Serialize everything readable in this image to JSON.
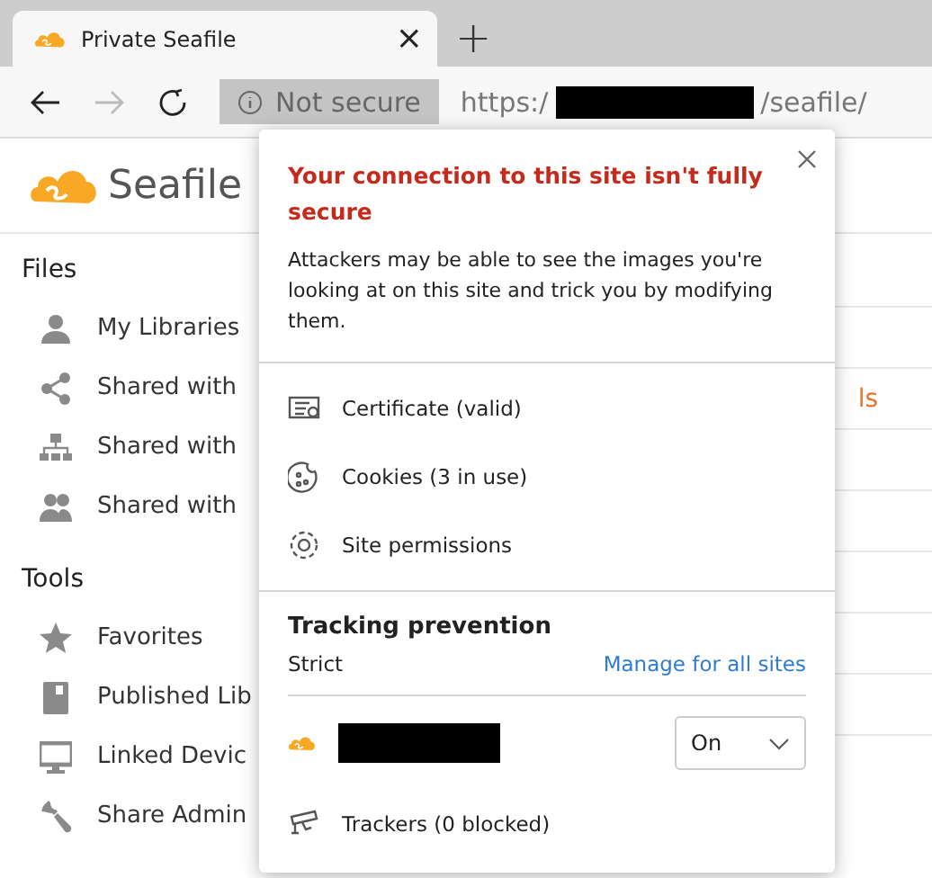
{
  "tabs": [
    {
      "title": "Private Seafile",
      "selected": true,
      "close": "×"
    }
  ],
  "new_tab": "+",
  "address": {
    "security": "Not secure",
    "url_start": "https:/",
    "url_end": "/seafile/"
  },
  "site": {
    "logo_text": "Seafile"
  },
  "sidebar": [
    {
      "heading": "Files",
      "items": [
        {
          "label": "My Libraries"
        },
        {
          "label": "Shared with"
        },
        {
          "label": "Shared with"
        },
        {
          "label": "Shared with"
        }
      ]
    },
    {
      "heading": "Tools",
      "items": [
        {
          "label": "Favorites"
        },
        {
          "label": "Published Lib"
        },
        {
          "label": "Linked Devic"
        },
        {
          "label": "Share Admin"
        }
      ]
    }
  ],
  "content": {
    "link_fragment": "ls"
  },
  "popup": {
    "title": "Your connection to this site isn't fully secure",
    "message": "Attackers may be able to see the images you're looking at on this site and trick you by modifying them.",
    "rows": [
      {
        "label": "Certificate (valid)"
      },
      {
        "label": "Cookies (3 in use)"
      },
      {
        "label": "Site permissions"
      }
    ],
    "tracking": {
      "title": "Tracking prevention",
      "level": "Strict",
      "manage_link": "Manage for all sites",
      "site_setting": "On",
      "trackers": "Trackers (0 blocked)"
    }
  }
}
